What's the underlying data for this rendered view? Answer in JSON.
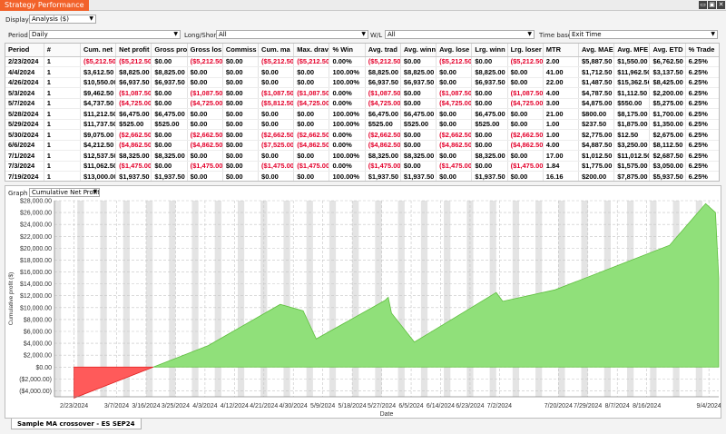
{
  "window": {
    "title": "Strategy Performance",
    "buttons": [
      "▭",
      "▣",
      "✕"
    ]
  },
  "controls": {
    "display_label": "Display",
    "display_value": "Analysis ($)",
    "period_label": "Period",
    "period_value": "Daily",
    "longshort_label": "Long/Short",
    "longshort_value": "All",
    "wl_label": "W/L",
    "wl_value": "All",
    "timebase_label": "Time base",
    "timebase_value": "Exit Time"
  },
  "table": {
    "columns": [
      "Period",
      "#",
      "Cum. net",
      "Net profit",
      "Gross pro",
      "Gross los",
      "Commiss",
      "Cum. ma",
      "Max. drav",
      "% Win",
      "Avg. trad",
      "Avg. winn",
      "Avg. lose",
      "Lrg. winn",
      "Lrg. loser",
      "MTR",
      "Avg. MAE",
      "Avg. MFE",
      "Avg. ETD",
      "% Trade"
    ],
    "rows": [
      [
        "2/23/2024",
        "1",
        "($5,212.50)",
        "($5,212.50)",
        "$0.00",
        "($5,212.50)",
        "$0.00",
        "($5,212.50)",
        "($5,212.50)",
        "0.00%",
        "($5,212.50)",
        "$0.00",
        "($5,212.50)",
        "$0.00",
        "($5,212.50)",
        "2.00",
        "$5,887.50",
        "$1,550.00",
        "$6,762.50",
        "6.25%"
      ],
      [
        "4/4/2024",
        "1",
        "$3,612.50",
        "$8,825.00",
        "$8,825.00",
        "$0.00",
        "$0.00",
        "$0.00",
        "$0.00",
        "100.00%",
        "$8,825.00",
        "$8,825.00",
        "$0.00",
        "$8,825.00",
        "$0.00",
        "41.00",
        "$1,712.50",
        "$11,962.50",
        "$3,137.50",
        "6.25%"
      ],
      [
        "4/26/2024",
        "1",
        "$10,550.00",
        "$6,937.50",
        "$6,937.50",
        "$0.00",
        "$0.00",
        "$0.00",
        "$0.00",
        "100.00%",
        "$6,937.50",
        "$6,937.50",
        "$0.00",
        "$6,937.50",
        "$0.00",
        "22.00",
        "$1,487.50",
        "$15,362.50",
        "$8,425.00",
        "6.25%"
      ],
      [
        "5/3/2024",
        "1",
        "$9,462.50",
        "($1,087.50)",
        "$0.00",
        "($1,087.50)",
        "$0.00",
        "($1,087.50)",
        "($1,087.50)",
        "0.00%",
        "($1,087.50)",
        "$0.00",
        "($1,087.50)",
        "$0.00",
        "($1,087.50)",
        "4.00",
        "$4,787.50",
        "$1,112.50",
        "$2,200.00",
        "6.25%"
      ],
      [
        "5/7/2024",
        "1",
        "$4,737.50",
        "($4,725.00)",
        "$0.00",
        "($4,725.00)",
        "$0.00",
        "($5,812.50)",
        "($4,725.00)",
        "0.00%",
        "($4,725.00)",
        "$0.00",
        "($4,725.00)",
        "$0.00",
        "($4,725.00)",
        "3.00",
        "$4,875.00",
        "$550.00",
        "$5,275.00",
        "6.25%"
      ],
      [
        "5/28/2024",
        "1",
        "$11,212.50",
        "$6,475.00",
        "$6,475.00",
        "$0.00",
        "$0.00",
        "$0.00",
        "$0.00",
        "100.00%",
        "$6,475.00",
        "$6,475.00",
        "$0.00",
        "$6,475.00",
        "$0.00",
        "21.00",
        "$800.00",
        "$8,175.00",
        "$1,700.00",
        "6.25%"
      ],
      [
        "5/29/2024",
        "1",
        "$11,737.50",
        "$525.00",
        "$525.00",
        "$0.00",
        "$0.00",
        "$0.00",
        "$0.00",
        "100.00%",
        "$525.00",
        "$525.00",
        "$0.00",
        "$525.00",
        "$0.00",
        "1.00",
        "$237.50",
        "$1,875.00",
        "$1,350.00",
        "6.25%"
      ],
      [
        "5/30/2024",
        "1",
        "$9,075.00",
        "($2,662.50)",
        "$0.00",
        "($2,662.50)",
        "$0.00",
        "($2,662.50)",
        "($2,662.50)",
        "0.00%",
        "($2,662.50)",
        "$0.00",
        "($2,662.50)",
        "$0.00",
        "($2,662.50)",
        "1.00",
        "$2,775.00",
        "$12.50",
        "$2,675.00",
        "6.25%"
      ],
      [
        "6/6/2024",
        "1",
        "$4,212.50",
        "($4,862.50)",
        "$0.00",
        "($4,862.50)",
        "$0.00",
        "($7,525.00)",
        "($4,862.50)",
        "0.00%",
        "($4,862.50)",
        "$0.00",
        "($4,862.50)",
        "$0.00",
        "($4,862.50)",
        "4.00",
        "$4,887.50",
        "$3,250.00",
        "$8,112.50",
        "6.25%"
      ],
      [
        "7/1/2024",
        "1",
        "$12,537.50",
        "$8,325.00",
        "$8,325.00",
        "$0.00",
        "$0.00",
        "$0.00",
        "$0.00",
        "100.00%",
        "$8,325.00",
        "$8,325.00",
        "$0.00",
        "$8,325.00",
        "$0.00",
        "17.00",
        "$1,012.50",
        "$11,012.50",
        "$2,687.50",
        "6.25%"
      ],
      [
        "7/3/2024",
        "1",
        "$11,062.50",
        "($1,475.00)",
        "$0.00",
        "($1,475.00)",
        "$0.00",
        "($1,475.00)",
        "($1,475.00)",
        "0.00%",
        "($1,475.00)",
        "$0.00",
        "($1,475.00)",
        "$0.00",
        "($1,475.00)",
        "1.84",
        "$1,775.00",
        "$1,575.00",
        "$3,050.00",
        "6.25%"
      ],
      [
        "7/19/2024",
        "1",
        "$13,000.00",
        "$1,937.50",
        "$1,937.50",
        "$0.00",
        "$0.00",
        "$0.00",
        "$0.00",
        "100.00%",
        "$1,937.50",
        "$1,937.50",
        "$0.00",
        "$1,937.50",
        "$0.00",
        "16.16",
        "$200.00",
        "$7,875.00",
        "$5,937.50",
        "6.25%"
      ]
    ]
  },
  "graph": {
    "label": "Graph",
    "selector": "Cumulative Net Profit",
    "tab_name": "Sample MA crossover - ES SEP24"
  },
  "colors": {
    "positive_fill": "#90e07a",
    "positive_line": "#5fbf3f",
    "negative_fill": "#ff5a5a",
    "negative_line": "#e02020",
    "negative_text": "#e4002b",
    "accent": "#f2622a",
    "weekend_band": "#e4e4e4"
  },
  "chart_data": {
    "type": "area",
    "xlabel": "Date",
    "ylabel": "Cumulative profit ($)",
    "ylim": [
      -5000,
      28000
    ],
    "yticks": [
      -4000,
      -2000,
      0,
      2000,
      4000,
      6000,
      8000,
      10000,
      12000,
      14000,
      16000,
      18000,
      20000,
      22000,
      24000,
      26000,
      28000
    ],
    "ytick_labels": [
      "($4,000.00)",
      "($2,000.00)",
      "$0.00",
      "$2,000.00",
      "$4,000.00",
      "$6,000.00",
      "$8,000.00",
      "$10,000.00",
      "$12,000.00",
      "$14,000.00",
      "$16,000.00",
      "$18,000.00",
      "$20,000.00",
      "$22,000.00",
      "$24,000.00",
      "$26,000.00",
      "$28,000.00"
    ],
    "xtick_labels": [
      "2/23/2024",
      "3/7/2024",
      "3/16/2024",
      "3/25/2024",
      "4/3/2024",
      "4/12/2024",
      "4/21/2024",
      "4/30/2024",
      "5/9/2024",
      "5/18/2024",
      "5/27/2024",
      "6/5/2024",
      "6/14/2024",
      "6/23/2024",
      "7/2/2024",
      "7/20/2024",
      "7/29/2024",
      "8/7/2024",
      "8/16/2024",
      "9/4/2024"
    ],
    "xtick_dates": [
      "2024-02-23",
      "2024-03-07",
      "2024-03-16",
      "2024-03-25",
      "2024-04-03",
      "2024-04-12",
      "2024-04-21",
      "2024-04-30",
      "2024-05-09",
      "2024-05-18",
      "2024-05-27",
      "2024-06-05",
      "2024-06-14",
      "2024-06-23",
      "2024-07-02",
      "2024-07-20",
      "2024-07-29",
      "2024-08-07",
      "2024-08-16",
      "2024-09-04"
    ],
    "x": [
      "2024-02-23",
      "2024-04-04",
      "2024-04-26",
      "2024-05-03",
      "2024-05-07",
      "2024-05-28",
      "2024-05-29",
      "2024-05-30",
      "2024-06-06",
      "2024-07-01",
      "2024-07-03",
      "2024-07-19",
      "2024-08-09",
      "2024-08-23",
      "2024-09-03",
      "2024-09-06",
      "2024-09-07"
    ],
    "values": [
      -5212.5,
      3612.5,
      10550,
      9462.5,
      4737.5,
      11212.5,
      11737.5,
      9075,
      4212.5,
      12537.5,
      11062.5,
      13000,
      17500,
      20500,
      27500,
      26000,
      15000
    ],
    "grid": true,
    "legend": "none"
  }
}
